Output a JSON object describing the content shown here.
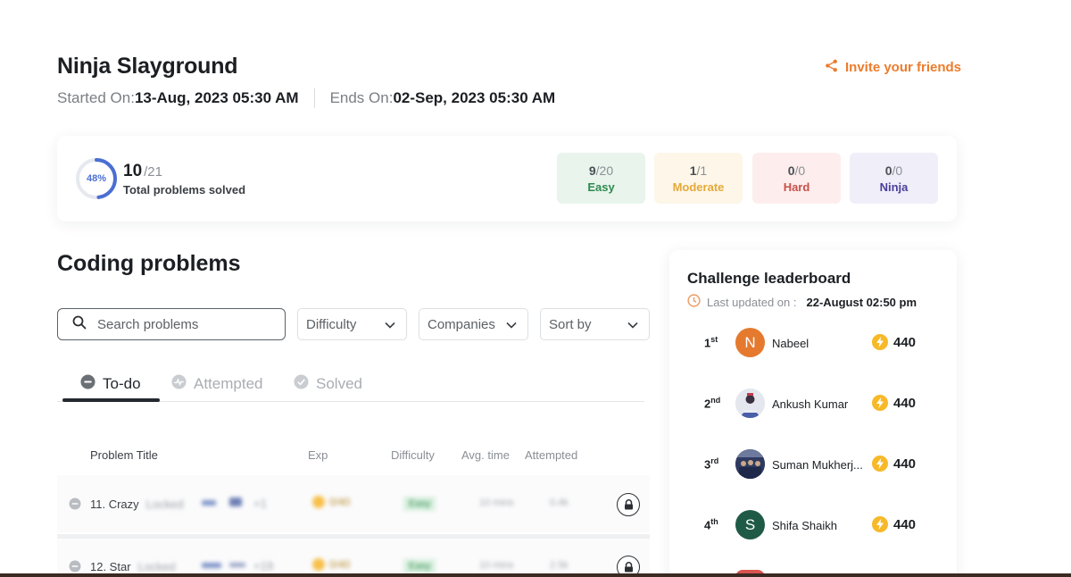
{
  "header": {
    "title": "Ninja Slayground",
    "started_label": "Started On:",
    "started_value": "13-Aug, 2023 05:30 AM",
    "ends_label": "Ends On:",
    "ends_value": "02-Sep, 2023 05:30 AM",
    "invite_label": "Invite your friends",
    "invite_icon": "share-icon"
  },
  "summary": {
    "percent_label": "48%",
    "percent": 48,
    "solved": "10",
    "total": "/21",
    "label": "Total problems solved",
    "difficulties": [
      {
        "solved": "9",
        "total": "/20",
        "name": "Easy",
        "bg": "#e8f4ec",
        "color": "#2f8a4e"
      },
      {
        "solved": "1",
        "total": "/1",
        "name": "Moderate",
        "bg": "#fdf6e9",
        "color": "#e5a93a"
      },
      {
        "solved": "0",
        "total": "/0",
        "name": "Hard",
        "bg": "#fdeeed",
        "color": "#c9504a"
      },
      {
        "solved": "0",
        "total": "/0",
        "name": "Ninja",
        "bg": "#efeef9",
        "color": "#4c3f9c"
      }
    ]
  },
  "problems": {
    "title": "Coding problems",
    "search_placeholder": "Search problems",
    "filters": [
      "Difficulty",
      "Companies",
      "Sort by"
    ],
    "tabs": [
      {
        "label": "To-do",
        "active": true
      },
      {
        "label": "Attempted",
        "active": false
      },
      {
        "label": "Solved",
        "active": false
      }
    ],
    "columns": [
      "Problem Title",
      "Exp",
      "Difficulty",
      "Avg. time",
      "Attempted"
    ],
    "rows": [
      {
        "title": "11. Crazy",
        "hidden_suffix": "Locked",
        "companies_more": "+1",
        "exp": "0/40",
        "difficulty": "Easy",
        "avg_time": "10 mins",
        "attempted": "0.4k"
      },
      {
        "title": "12. Star",
        "hidden_suffix": "Locked",
        "companies_more": "+19",
        "exp": "0/40",
        "difficulty": "Easy",
        "avg_time": "10 mins",
        "attempted": "2.5k"
      }
    ]
  },
  "leaderboard": {
    "title": "Challenge leaderboard",
    "updated_label": "Last updated on :",
    "updated_value": "22-August 02:50 pm",
    "entries": [
      {
        "rank": "1",
        "suffix": "st",
        "name": "Nabeel",
        "initial": "N",
        "avatar_color": "#e57a2e",
        "score": "440"
      },
      {
        "rank": "2",
        "suffix": "nd",
        "name": "Ankush Kumar",
        "initial": "",
        "avatar_color": "#cfd6e6",
        "score": "440"
      },
      {
        "rank": "3",
        "suffix": "rd",
        "name": "Suman Mukherj...",
        "initial": "",
        "avatar_color": "#3c4c7a",
        "score": "440"
      },
      {
        "rank": "4",
        "suffix": "th",
        "name": "Shifa Shaikh",
        "initial": "S",
        "avatar_color": "#1f5a46",
        "score": "440"
      }
    ]
  }
}
